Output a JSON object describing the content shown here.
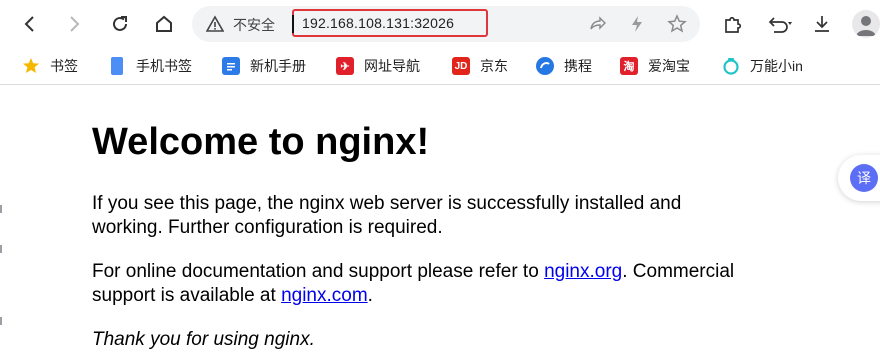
{
  "toolbar": {
    "back_icon": "back-arrow-icon",
    "forward_icon": "forward-arrow-icon",
    "reload_icon": "reload-icon",
    "home_icon": "home-icon"
  },
  "omnibox": {
    "security_label": "不安全",
    "url": "192.168.108.131:32026"
  },
  "bookmarks": [
    {
      "label": "书签",
      "icon": "star-icon",
      "color": "#f6b700"
    },
    {
      "label": "手机书签",
      "icon": "phone-icon",
      "color": "#4c8df6"
    },
    {
      "label": "新机手册",
      "icon": "book-icon",
      "color": "#2d7be6"
    },
    {
      "label": "网址导航",
      "icon": "site-nav-icon",
      "color": "#e0202a"
    },
    {
      "label": "京东",
      "icon": "jd-icon",
      "color": "#e1251b"
    },
    {
      "label": "携程",
      "icon": "ctrip-icon",
      "color": "#2577e3"
    },
    {
      "label": "爱淘宝",
      "icon": "taobao-icon",
      "color": "#e0202a"
    },
    {
      "label": "万能小in",
      "icon": "wanneng-icon",
      "color": "#21c4c9"
    }
  ],
  "page": {
    "title": "Welcome to nginx!",
    "p1": "If you see this page, the nginx web server is successfully installed and working. Further configuration is required.",
    "p2_prefix": "For online documentation and support please refer to ",
    "p2_link1": "nginx.org",
    "p2_mid": ". Commercial support is available at ",
    "p2_link2": "nginx.com",
    "p2_suffix": ".",
    "p3": "Thank you for using nginx."
  },
  "translate": {
    "label": "译"
  }
}
